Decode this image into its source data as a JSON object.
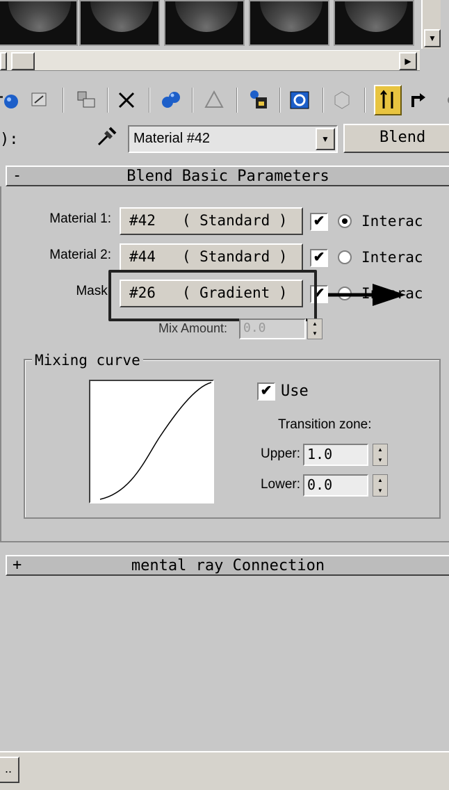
{
  "name_row": {
    "prefix": "):",
    "material_name": "Material #42",
    "type_button": "Blend"
  },
  "rollouts": {
    "basic": {
      "toggle": "-",
      "title": "Blend Basic Parameters"
    },
    "mental_ray": {
      "toggle": "+",
      "title": "mental ray Connection"
    }
  },
  "basic": {
    "rows": [
      {
        "label": "Material 1:",
        "map": "#42   ( Standard )",
        "enabled": "✔",
        "interactive": "Interac"
      },
      {
        "label": "Material 2:",
        "map": "#44   ( Standard )",
        "enabled": "✔",
        "interactive": "Interac"
      },
      {
        "label": "Mask:",
        "map": "#26   ( Gradient )",
        "enabled": "✔",
        "interactive": "Interac"
      }
    ],
    "mix_amount_label": "Mix Amount:",
    "mix_amount_value": "0.0"
  },
  "mixing_curve": {
    "title": "Mixing curve",
    "use_label": "Use",
    "use_checked": "✔",
    "transition_label": "Transition zone:",
    "upper_label": "Upper:",
    "upper_value": "1.0",
    "lower_label": "Lower:",
    "lower_value": "0.0"
  },
  "status": {
    "button": ".."
  },
  "colors": {
    "highlight_button": "#e8c440",
    "panel_bg": "#c8c8c8"
  }
}
